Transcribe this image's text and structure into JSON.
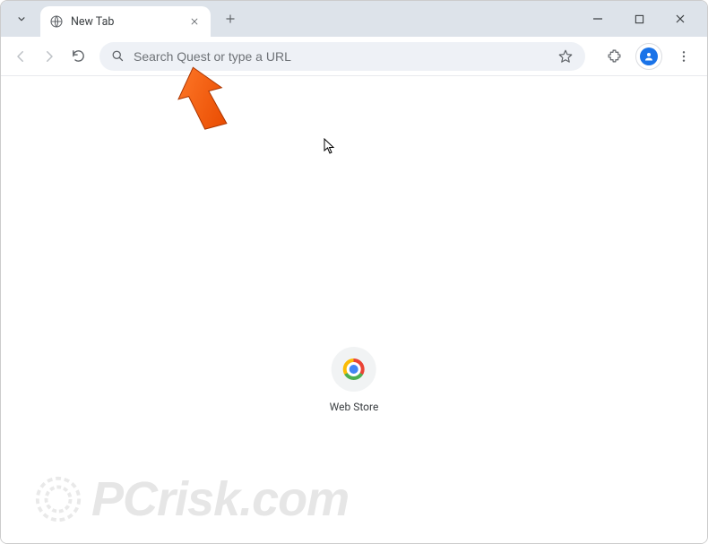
{
  "tab": {
    "title": "New Tab"
  },
  "omnibox": {
    "placeholder": "Search Quest or type a URL"
  },
  "shortcut": {
    "label": "Web Store"
  },
  "watermark": {
    "text": "PCrisk.com"
  }
}
